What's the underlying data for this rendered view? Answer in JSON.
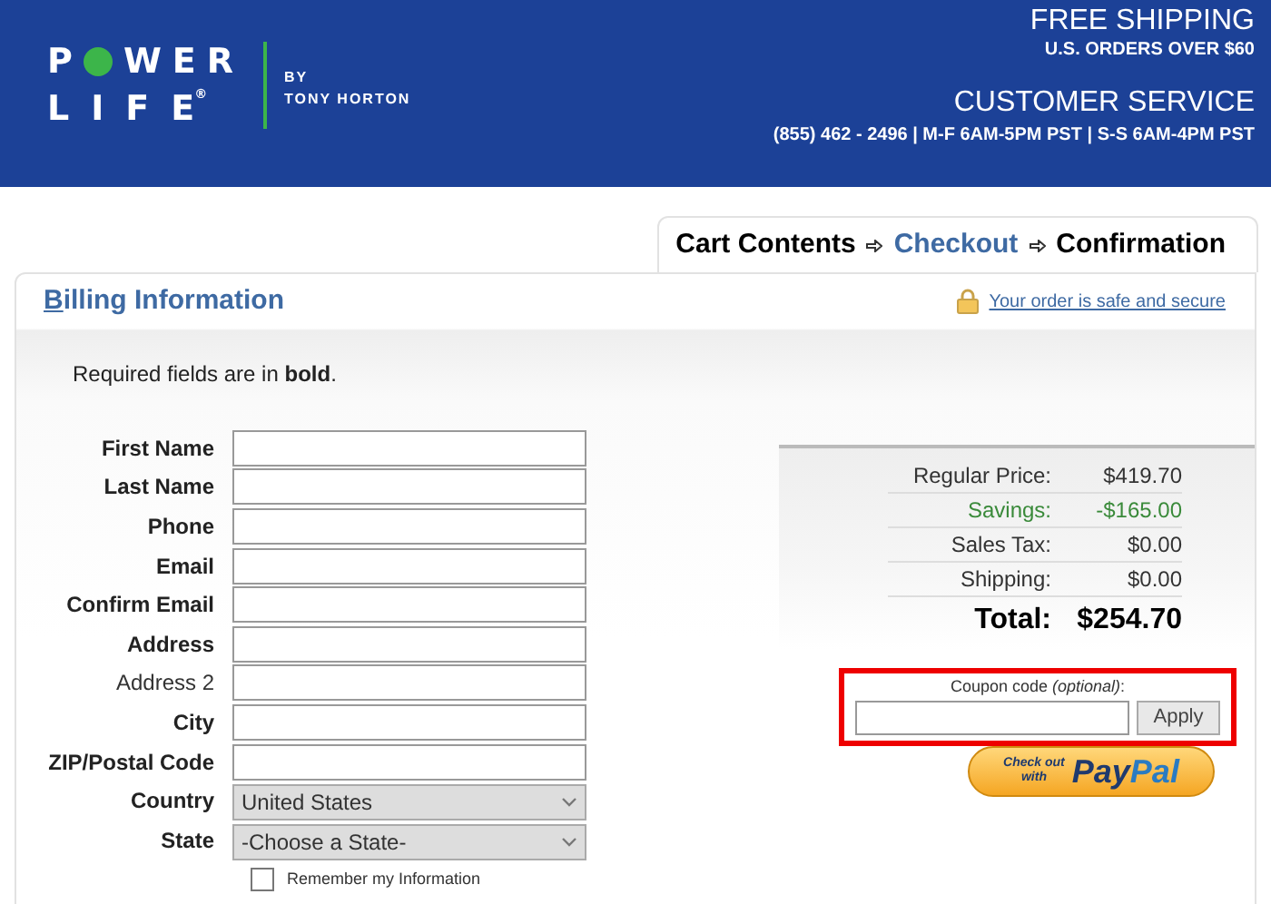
{
  "header": {
    "logo": {
      "line1_start": "P",
      "line1_end": "WER",
      "line2": "LIFE",
      "registered": "®",
      "byline_1": "BY",
      "byline_2": "TONY HORTON"
    },
    "promo_title": "FREE SHIPPING",
    "promo_detail": "U.S. ORDERS OVER $60",
    "service_title": "CUSTOMER SERVICE",
    "service_detail": "(855) 462 - 2496 | M-F 6AM-5PM PST | S-S 6AM-4PM PST"
  },
  "breadcrumb": [
    {
      "label": "Cart Contents",
      "selected": false
    },
    {
      "label": "Checkout",
      "selected": true
    },
    {
      "label": "Confirmation",
      "selected": false
    }
  ],
  "panel": {
    "title_initial": "B",
    "title_rest": "illing Information",
    "secure_link": "Your order is safe and secure",
    "note": "Required fields are in **bold**."
  },
  "fields": [
    {
      "kind": "text",
      "label": "First Name",
      "required": true
    },
    {
      "kind": "text",
      "label": "Last Name",
      "required": true
    },
    {
      "kind": "text",
      "label": "Phone",
      "required": true
    },
    {
      "kind": "text",
      "label": "Email",
      "required": true
    },
    {
      "kind": "text",
      "label": "Confirm Email",
      "required": true
    },
    {
      "kind": "text",
      "label": "Address",
      "required": true
    },
    {
      "kind": "text",
      "label": "Address 2",
      "required": false
    },
    {
      "kind": "text",
      "label": "City",
      "required": true
    },
    {
      "kind": "text",
      "label": "ZIP/Postal Code",
      "required": true
    },
    {
      "kind": "select",
      "label": "Country",
      "required": true,
      "value": "United States"
    },
    {
      "kind": "select",
      "label": "State",
      "required": true,
      "value": "-Choose a State-"
    }
  ],
  "remember": {
    "label": "Remember my Information",
    "checked": false
  },
  "summary": [
    {
      "kind": "normal",
      "label": "Regular Price:",
      "value": "$419.70"
    },
    {
      "kind": "savings",
      "label": "Savings:",
      "value": "-$165.00"
    },
    {
      "kind": "normal",
      "label": "Sales Tax:",
      "value": "$0.00"
    },
    {
      "kind": "normal",
      "label": "Shipping:",
      "value": "$0.00"
    },
    {
      "kind": "total",
      "label": "Total:",
      "value": "$254.70"
    }
  ],
  "coupon": {
    "label": "Coupon code *(optional)*:",
    "button": "Apply"
  },
  "paypal": {
    "line1": "Check out",
    "line2": "with",
    "brand_1": "Pay",
    "brand_2": "Pal"
  }
}
